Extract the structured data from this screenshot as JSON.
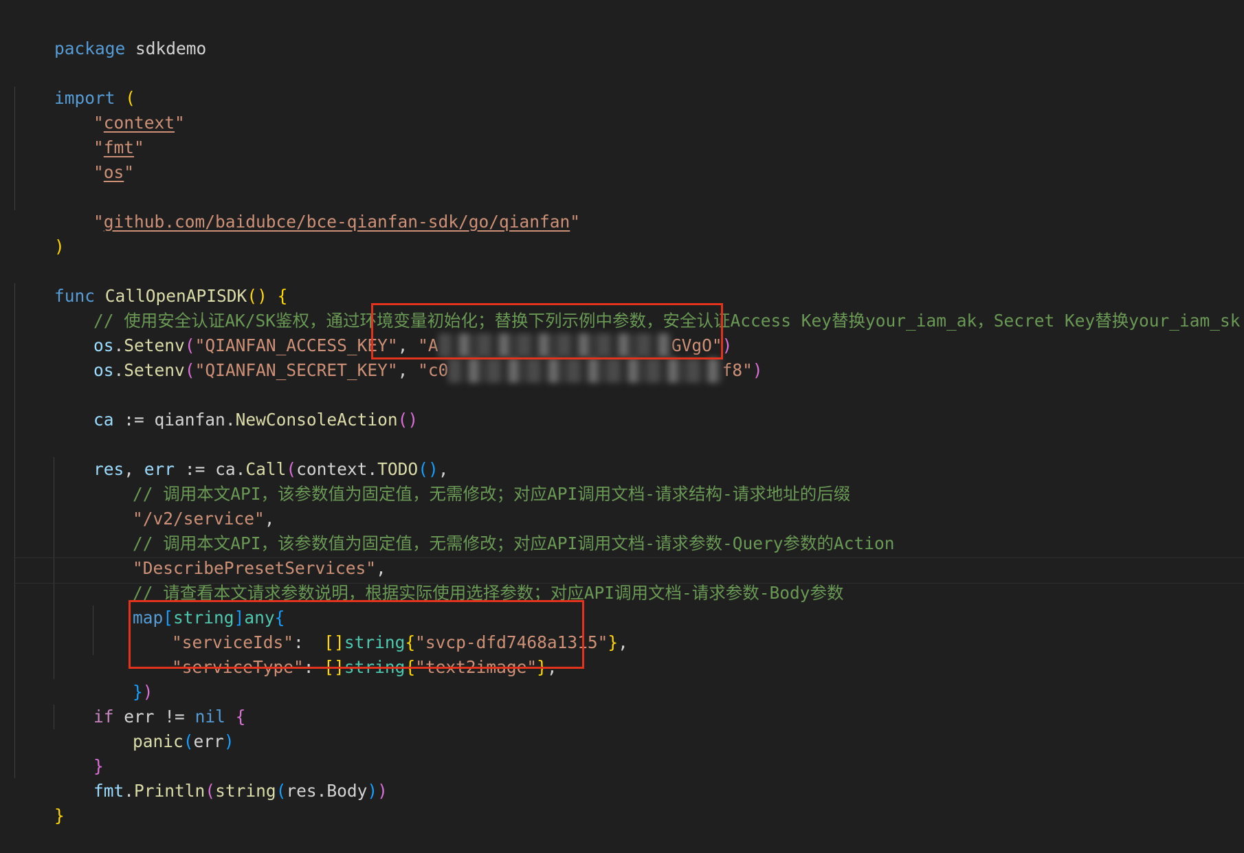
{
  "code": {
    "l1": {
      "kw": "package",
      "name": " sdkdemo"
    },
    "l2": {
      "kw": "import",
      "paren": "("
    },
    "l3": {
      "s": "context"
    },
    "l4": {
      "s": "fmt"
    },
    "l5": {
      "s": "os"
    },
    "l6": {
      "s": "github.com/baidubce/bce-qianfan-sdk/go/qianfan"
    },
    "l7": {
      "paren": ")"
    },
    "l8": {
      "kw": "func",
      "name": "CallOpenAPISDK",
      "parens": "()",
      "brace": "{"
    },
    "l9": {
      "comment": "// 使用安全认证AK/SK鉴权，通过环境变量初始化；替换下列示例中参数，安全认证Access Key替换your_iam_ak，Secret Key替换your_iam_sk"
    },
    "l10": {
      "pkg": "os",
      "dot": ".",
      "fn": "Setenv",
      "open": "(",
      "arg1": "\"QIANFAN_ACCESS_KEY\"",
      "comma": ", ",
      "arg2_start": "\"A",
      "arg2_end": "GVgO\"",
      "close": ")"
    },
    "l11": {
      "pkg": "os",
      "dot": ".",
      "fn": "Setenv",
      "open": "(",
      "arg1": "\"QIANFAN_SECRET_KEY\"",
      "comma": ", ",
      "arg2_start": "\"c0",
      "arg2_end": "f8\"",
      "close": ")"
    },
    "l12": {
      "v": "ca",
      "op": " := ",
      "pkg": "qianfan",
      "dot": ".",
      "fn": "NewConsoleAction",
      "parens": "()"
    },
    "l13": {
      "v1": "res",
      "c1": ", ",
      "v2": "err",
      "op": " := ",
      "obj": "ca",
      "dot": ".",
      "fn": "Call",
      "open": "(",
      "pkg": "context",
      "dot2": ".",
      "fn2": "TODO",
      "parens": "()",
      "comma": ","
    },
    "l14": {
      "comment": "// 调用本文API，该参数值为固定值，无需修改；对应API调用文档-请求结构-请求地址的后缀"
    },
    "l15": {
      "s": "\"/v2/service\"",
      "comma": ","
    },
    "l16": {
      "comment": "// 调用本文API，该参数值为固定值，无需修改；对应API调用文档-请求参数-Query参数的Action"
    },
    "l17": {
      "s": "\"DescribePresetServices\"",
      "comma": ","
    },
    "l18": {
      "comment": "// 请查看本文请求参数说明，根据实际使用选择参数；对应API调用文档-请求参数-Body参数"
    },
    "l19": {
      "map": "map",
      "ob": "[",
      "t": "string",
      "cb": "]",
      "any": "any",
      "brace": "{"
    },
    "l20": {
      "key": "\"serviceIds\"",
      "colon": ":  ",
      "br": "[]",
      "t": "string",
      "ob": "{",
      "val": "\"svcp-dfd7468a1315\"",
      "cb": "}",
      "comma": ","
    },
    "l21": {
      "key": "\"serviceType\"",
      "colon": ": ",
      "br": "[]",
      "t": "string",
      "ob": "{",
      "val": "\"text2image\"",
      "cb": "}",
      "comma": ","
    },
    "l22": {
      "cb": "}",
      "cp": ")"
    },
    "l23": {
      "kw": "if",
      "v": " err ",
      "op": "!=",
      "nil": " nil",
      "brace": " {"
    },
    "l24": {
      "fn": "panic",
      "open": "(",
      "v": "err",
      "close": ")"
    },
    "l25": {
      "brace": "}"
    },
    "l26": {
      "pkg": "fmt",
      "dot": ".",
      "fn": "Println",
      "open": "(",
      "fn2": "string",
      "open2": "(",
      "v": "res",
      "dot2": ".",
      "field": "Body",
      "close2": ")",
      "close": ")"
    },
    "l27": {
      "brace": "}"
    }
  },
  "colors": {
    "background": "#1f1f1f",
    "keyword": "#569cd6",
    "control": "#c586c0",
    "function": "#dcdcaa",
    "string": "#ce9178",
    "comment": "#6a9955",
    "variable": "#9cdcfe",
    "type": "#4ec9b0",
    "highlight_box": "#e3331d"
  }
}
